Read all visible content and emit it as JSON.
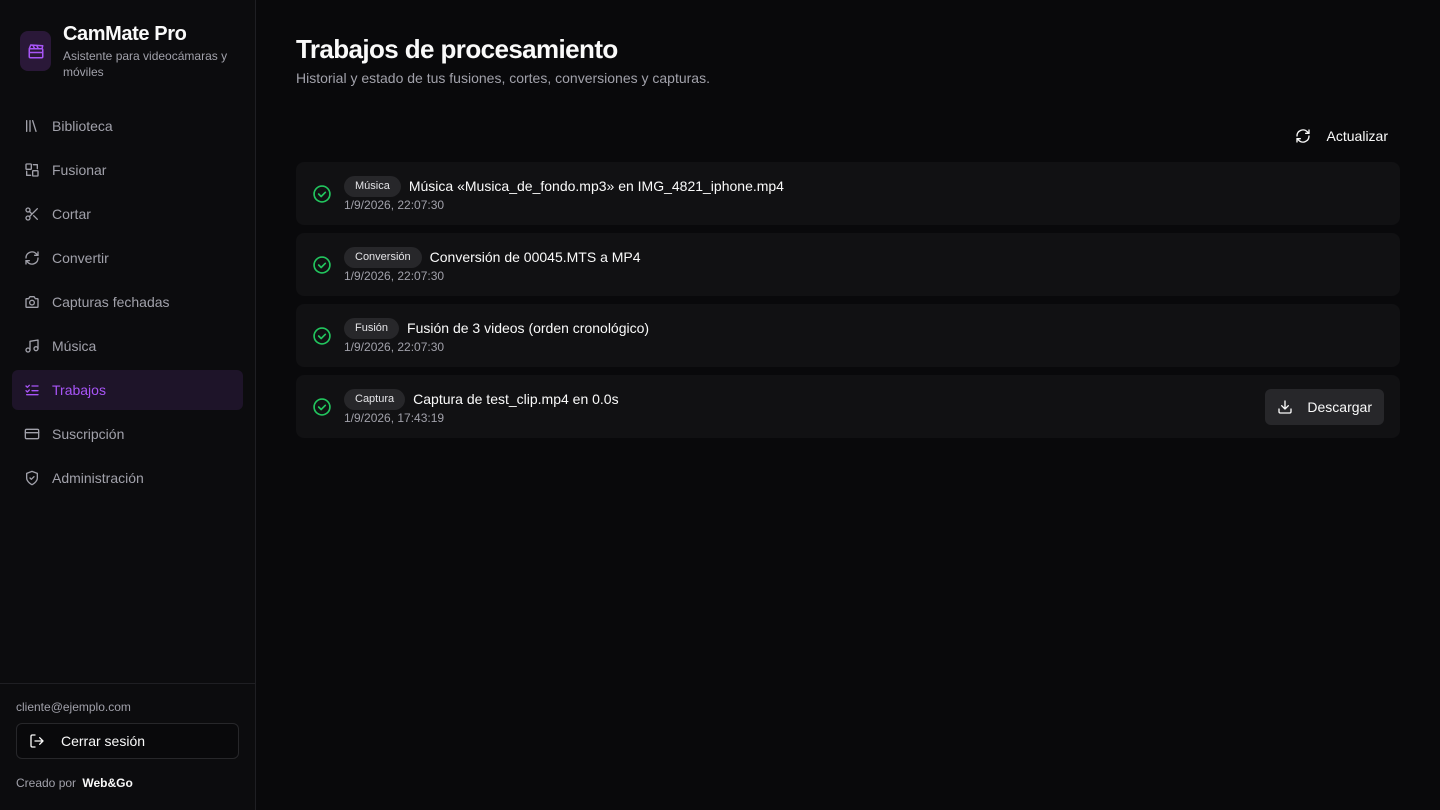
{
  "brand": {
    "title": "CamMate Pro",
    "subtitle": "Asistente para videocámaras y móviles",
    "accent": "#a855f7",
    "logo_icon": "clapperboard-icon"
  },
  "sidebar": {
    "items": [
      {
        "label": "Biblioteca",
        "icon": "library-icon"
      },
      {
        "label": "Fusionar",
        "icon": "merge-icon"
      },
      {
        "label": "Cortar",
        "icon": "scissors-icon"
      },
      {
        "label": "Convertir",
        "icon": "refresh-icon"
      },
      {
        "label": "Capturas fechadas",
        "icon": "camera-icon"
      },
      {
        "label": "Música",
        "icon": "music-icon"
      },
      {
        "label": "Trabajos",
        "icon": "list-checks-icon",
        "active": true
      },
      {
        "label": "Suscripción",
        "icon": "credit-card-icon"
      },
      {
        "label": "Administración",
        "icon": "shield-check-icon"
      }
    ],
    "user_email": "cliente@ejemplo.com",
    "logout_label": "Cerrar sesión",
    "credit_prefix": "Creado por",
    "credit_name": "Web&Go"
  },
  "main": {
    "title": "Trabajos de procesamiento",
    "subtitle": "Historial y estado de tus fusiones, cortes, conversiones y capturas.",
    "refresh_label": "Actualizar",
    "download_label": "Descargar",
    "status_color": "#22c55e",
    "jobs": [
      {
        "badge": "Música",
        "title": "Música «Musica_de_fondo.mp3» en IMG_4821_iphone.mp4",
        "time": "1/9/2026, 22:07:30",
        "status": "completed"
      },
      {
        "badge": "Conversión",
        "title": "Conversión de 00045.MTS a MP4",
        "time": "1/9/2026, 22:07:30",
        "status": "completed"
      },
      {
        "badge": "Fusión",
        "title": "Fusión de 3 videos (orden cronológico)",
        "time": "1/9/2026, 22:07:30",
        "status": "completed"
      },
      {
        "badge": "Captura",
        "title": "Captura de test_clip.mp4 en 0.0s",
        "time": "1/9/2026, 17:43:19",
        "status": "completed",
        "downloadable": true
      }
    ]
  }
}
